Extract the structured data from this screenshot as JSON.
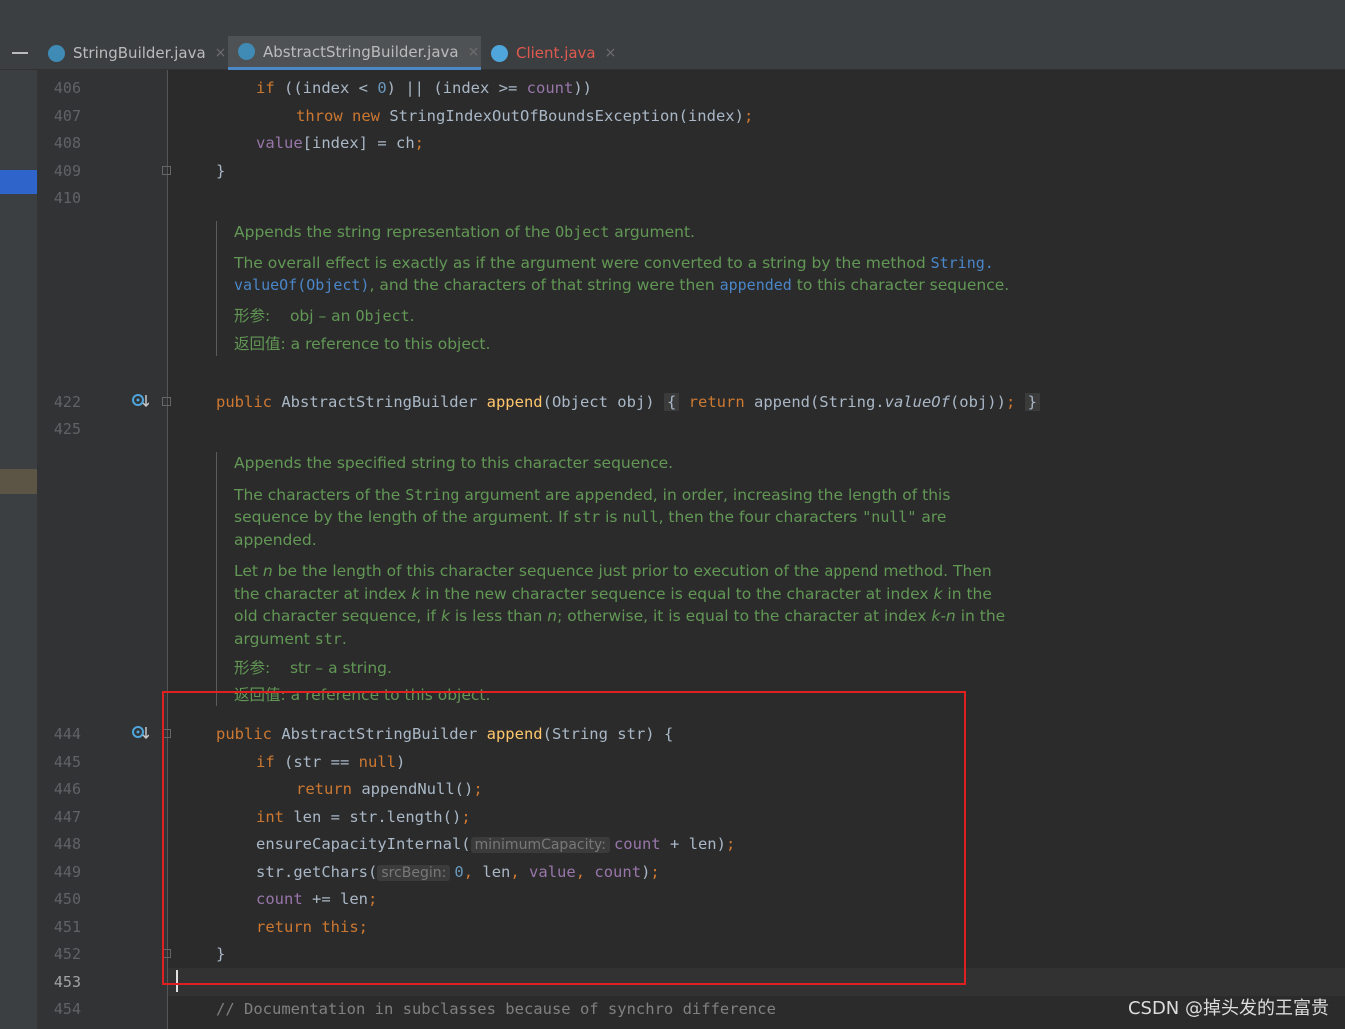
{
  "tabs": [
    {
      "label": "StringBuilder.java",
      "close": "×",
      "active": false
    },
    {
      "label": "AbstractStringBuilder.java",
      "close": "×",
      "active": true
    },
    {
      "label": "Client.java",
      "close": "×",
      "active": false,
      "color": "#e0594f"
    }
  ],
  "line_numbers": {
    "l406": "406",
    "l407": "407",
    "l408": "408",
    "l409": "409",
    "l410": "410",
    "l422": "422",
    "l425": "425",
    "l444": "444",
    "l445": "445",
    "l446": "446",
    "l447": "447",
    "l448": "448",
    "l449": "449",
    "l450": "450",
    "l451": "451",
    "l452": "452",
    "l453": "453",
    "l454": "454"
  },
  "code": {
    "l406": {
      "kw_if": "if",
      "a": " ((index < ",
      "zero": "0",
      "b": ") || (index >= ",
      "count": "count",
      "c": "))"
    },
    "l407": {
      "kw_throw": "throw",
      "sp": " ",
      "kw_new": "new",
      "rest": " StringIndexOutOfBoundsException(index)",
      "semi": ";"
    },
    "l408": {
      "value": "value",
      "rest": "[index] = ch",
      "semi": ";"
    },
    "l409": {
      "brace": "}"
    },
    "l422": {
      "kw_public": "public",
      "type": " AbstractStringBuilder ",
      "method": "append",
      "params": "(Object obj) ",
      "lbrace": "{",
      "sp": " ",
      "kw_return": "return",
      "call": " append(String.",
      "valueof": "valueOf",
      "args": "(obj))",
      "semi": ";",
      "sp2": " ",
      "rbrace": "}"
    },
    "l444": {
      "kw_public": "public",
      "type": " AbstractStringBuilder ",
      "method": "append",
      "params": "(String str) {"
    },
    "l445": {
      "kw_if": "if",
      "a": " (str == ",
      "kw_null": "null",
      "b": ")"
    },
    "l446": {
      "kw_return": "return",
      "rest": " appendNull()",
      "semi": ";"
    },
    "l447": {
      "kw_int": "int",
      "rest": " len = str.length()",
      "semi": ";"
    },
    "l448": {
      "call": "ensureCapacityInternal(",
      "hint": "minimumCapacity:",
      "count": "count",
      "rest": " + len)",
      "semi": ";"
    },
    "l449": {
      "call": "str.getChars(",
      "hint": "srcBegin:",
      "zero": "0",
      "c1": ", ",
      "len": "len",
      "c2": ", ",
      "value": "value",
      "c3": ", ",
      "count": "count",
      "end": ")",
      "semi": ";"
    },
    "l450": {
      "count": "count",
      "rest": " += len",
      "semi": ";"
    },
    "l451": {
      "kw_return": "return",
      "sp": " ",
      "kw_this": "this",
      "semi": ";"
    },
    "l452": {
      "brace": "}"
    },
    "l454": {
      "comment": "// Documentation in subclasses because of synchro difference"
    }
  },
  "doc1": {
    "p1_a": "Appends the string representation of the ",
    "p1_code": "Object",
    "p1_b": " argument.",
    "p2_a": "The overall effect is exactly as if the argument were converted to a string by the method ",
    "p2_link1": "String.",
    "p2_link2": "valueOf(Object)",
    "p2_b": ", and the characters of that string were then ",
    "p2_link3": "appended",
    "p2_c": " to this character sequence.",
    "param_label": "形参:",
    "param_a": "obj – an ",
    "param_code": "Object",
    "param_b": ".",
    "return_label": "返回值:",
    "return_text": "a reference to this object."
  },
  "doc2": {
    "p1": "Appends the specified string to this character sequence.",
    "p2_a": "The characters of the ",
    "p2_code1": "String",
    "p2_b": " argument are appended, in order, increasing the length of this sequence by the length of the argument. If ",
    "p2_code2": "str",
    "p2_c": " is ",
    "p2_code3": "null",
    "p2_d": ", then the four characters ",
    "p2_code4": "\"null\"",
    "p2_e": " are appended.",
    "p3_a": "Let ",
    "p3_n1": "n",
    "p3_b": " be the length of this character sequence just prior to execution of the ",
    "p3_code1": "append",
    "p3_c": " method. Then the character at index ",
    "p3_k1": "k",
    "p3_d": " in the new character sequence is equal to the character at index ",
    "p3_k2": "k",
    "p3_e": " in the old character sequence, if ",
    "p3_k3": "k",
    "p3_f": " is less than ",
    "p3_n2": "n",
    "p3_g": "; otherwise, it is equal to the character at index ",
    "p3_kn": "k-n",
    "p3_h": " in the argument ",
    "p3_code2": "str",
    "p3_i": ".",
    "param_label": "形参:",
    "param_text": "str – a string.",
    "return_label": "返回值:",
    "return_text": "a reference to this object."
  },
  "watermark": "CSDN @掉头发的王富贵",
  "colors": {
    "keyword": "#cc7832",
    "field": "#9876aa",
    "method": "#ffc66d",
    "number": "#6897bb",
    "doc": "#629755",
    "link": "#4a86c8",
    "highlight_box": "#e02020"
  }
}
